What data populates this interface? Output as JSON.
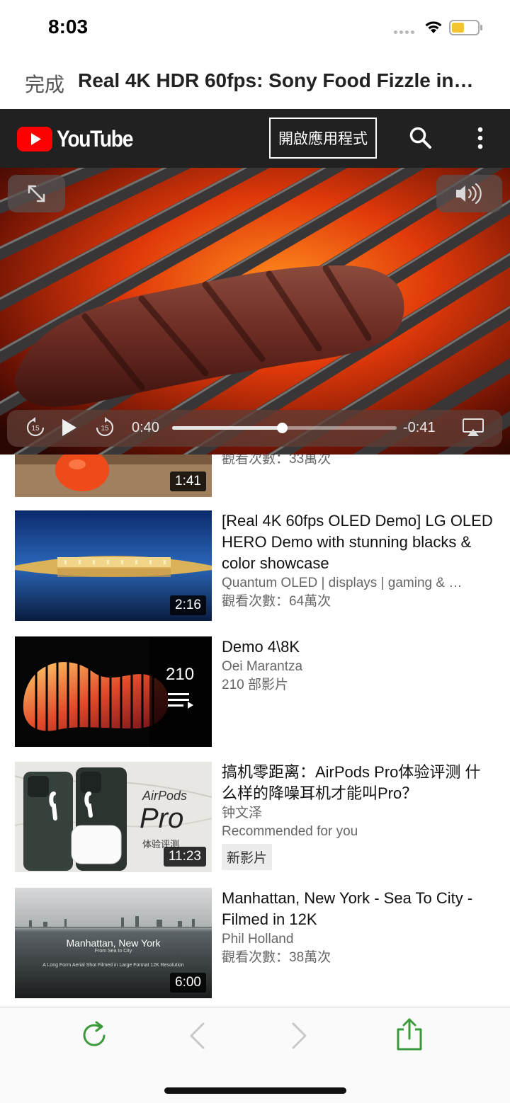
{
  "status_bar": {
    "time": "8:03",
    "battery_color": "#f5c431"
  },
  "browser": {
    "done_label": "完成",
    "page_title": "Real 4K HDR 60fps: Sony Food Fizzle in…"
  },
  "youtube": {
    "logo_text": "YouTube",
    "open_app_label": "開啟應用程式",
    "brand_red": "#ff0000"
  },
  "player": {
    "time_current": "0:40",
    "time_remaining": "-0:41",
    "progress": 0.49,
    "skip_back_seconds": "15",
    "skip_forward_seconds": "15"
  },
  "list": {
    "partial": {
      "views": "觀看次數：33萬次",
      "duration": "1:41"
    },
    "items": [
      {
        "title": "[Real 4K 60fps OLED Demo] LG OLED HERO Demo with stunning blacks & color showcase",
        "channel": "Quantum OLED | displays | gaming & …",
        "views": "觀看次數：64萬次",
        "duration": "2:16"
      },
      {
        "title": "Demo 4\\8K",
        "channel": "Oei Marantza",
        "views": "210 部影片",
        "playlist_count": "210"
      },
      {
        "title": "搞机零距离：AirPods Pro体验评测 什么样的降噪耳机才能叫Pro？",
        "channel": "钟文泽",
        "recommendation": "Recommended for you",
        "badge": "新影片",
        "duration": "11:23",
        "thumb_text_1": "AirPods",
        "thumb_text_2": "Pro",
        "thumb_text_3": "体验评测"
      },
      {
        "title": "Manhattan, New York - Sea To City - Filmed in 12K",
        "channel": "Phil Holland",
        "views": "觀看次數：38萬次",
        "duration": "6:00",
        "thumb_title": "Manhattan, New York",
        "thumb_subtitle": "From Sea to City",
        "thumb_caption": "A Long Form Aerial Shot Filmed in Large Format 12K Resolution"
      }
    ]
  },
  "toolbar": {
    "accent_color": "#3c9a3c"
  }
}
